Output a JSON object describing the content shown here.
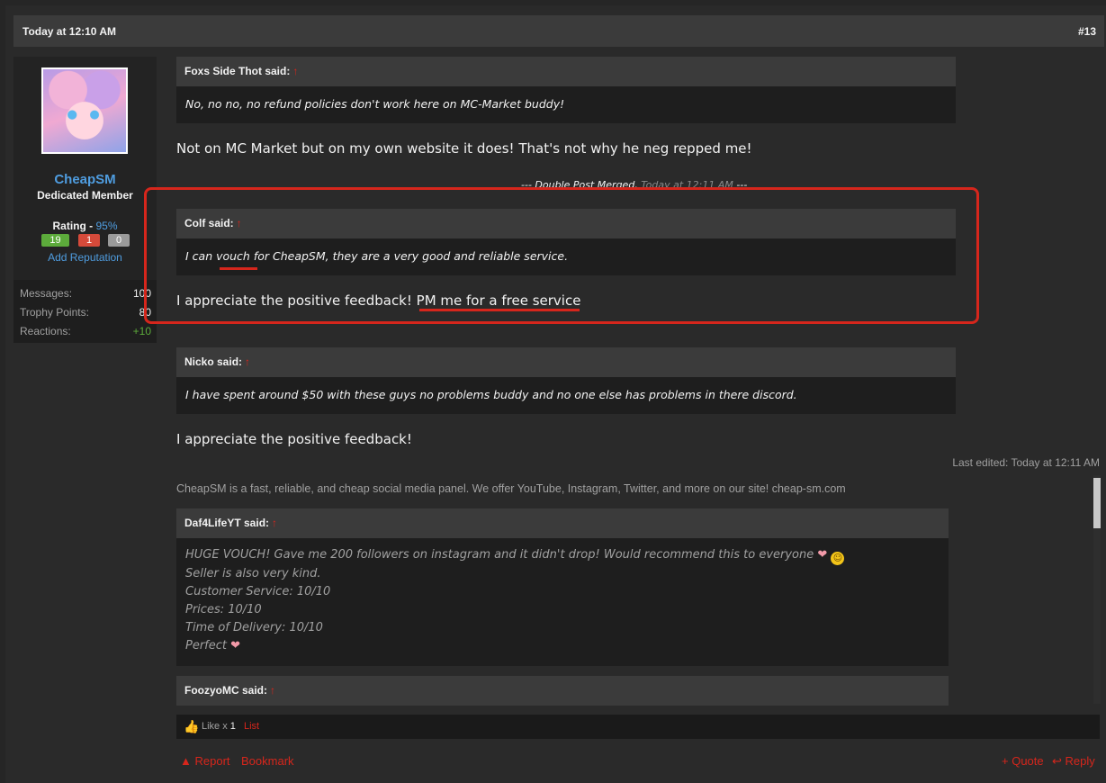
{
  "post": {
    "date": "Today at 12:10 AM",
    "number": "#13"
  },
  "user": {
    "name": "CheapSM",
    "title": "Dedicated Member",
    "rating_label": "Rating - ",
    "rating_pct": "95%",
    "rep_positive": "19",
    "rep_negative": "1",
    "rep_neutral": "0",
    "add_reputation": "Add Reputation",
    "stats": [
      {
        "label": "Messages:",
        "value": "100"
      },
      {
        "label": "Trophy Points:",
        "value": "80"
      },
      {
        "label": "Reactions:",
        "value": "+10"
      }
    ]
  },
  "content": {
    "quote1": {
      "author": "Foxs Side Thot said:",
      "text": "No, no no, no refund policies don't work here on MC-Market buddy!"
    },
    "reply1": "Not on MC Market but on my own website it does! That's not why he neg repped me!",
    "merged_label": "--- Double Post Merged, ",
    "merged_time": "Today at 12:11 AM",
    "merged_end": " ---",
    "quote2": {
      "author": "Colf said:",
      "text": "I can vouch for CheapSM, they are a very good and reliable service."
    },
    "reply2": "I appreciate the positive feedback! PM me for a free service",
    "quote3": {
      "author": "Nicko said:",
      "text": "I have spent around $50 with these guys no problems buddy and no one else has problems in there discord."
    },
    "reply3": "I appreciate the positive feedback!",
    "last_edited": "Last edited: Today at 12:11 AM",
    "arrow": "↑"
  },
  "signature": {
    "text": "CheapSM is a fast, reliable, and cheap social media panel. We offer YouTube, Instagram, Twitter, and more on our site! cheap-sm.com",
    "quote1_author": "Daf4LifeYT said:",
    "lines": [
      "HUGE VOUCH! Gave me 200 followers on instagram and it didn't drop! Would recommend this to everyone",
      "Seller is also very kind.",
      "Customer Service: 10/10",
      "Prices: 10/10",
      "Time of Delivery: 10/10",
      "Perfect"
    ],
    "quote2_author": "FoozyoMC said:"
  },
  "likes": {
    "text": "Like x ",
    "count": "1",
    "list": "List"
  },
  "actions": {
    "report": "Report",
    "bookmark": "Bookmark",
    "quote": "+ Quote",
    "reply": "Reply"
  },
  "colors": {
    "accent_red": "#d6261c",
    "link_blue": "#4f9de0"
  }
}
